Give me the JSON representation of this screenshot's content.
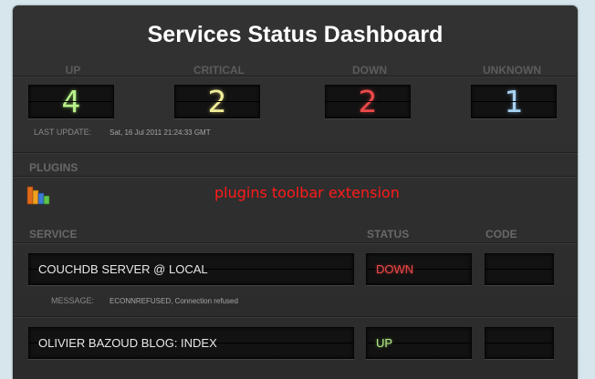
{
  "title": "Services Status Dashboard",
  "counters": {
    "up": {
      "label": "UP",
      "value": "4"
    },
    "critical": {
      "label": "CRITICAL",
      "value": "2"
    },
    "down": {
      "label": "DOWN",
      "value": "2"
    },
    "unknown": {
      "label": "UNKNOWN",
      "value": "1"
    }
  },
  "last_update": {
    "label": "LAST UPDATE:",
    "value": "Sat, 16 Jul 2011 21:24:33 GMT"
  },
  "plugins": {
    "label": "PLUGINS",
    "icon": "bar-chart-icon",
    "link_text": "plugins toolbar extension"
  },
  "table": {
    "headers": {
      "service": "SERVICE",
      "status": "STATUS",
      "code": "CODE"
    },
    "rows": [
      {
        "service": "COUCHDB SERVER @ LOCAL",
        "status": "DOWN",
        "code": "",
        "message_label": "MESSAGE:",
        "message": "ECONNREFUSED, Connection refused"
      },
      {
        "service": "OLIVIER BAZOUD BLOG: INDEX",
        "status": "UP",
        "code": ""
      }
    ]
  },
  "colors": {
    "up": "#b8f08a",
    "critical": "#f1ee9a",
    "down": "#ec4a4a",
    "unknown": "#a6d2f2",
    "link": "#ff1a1a"
  }
}
